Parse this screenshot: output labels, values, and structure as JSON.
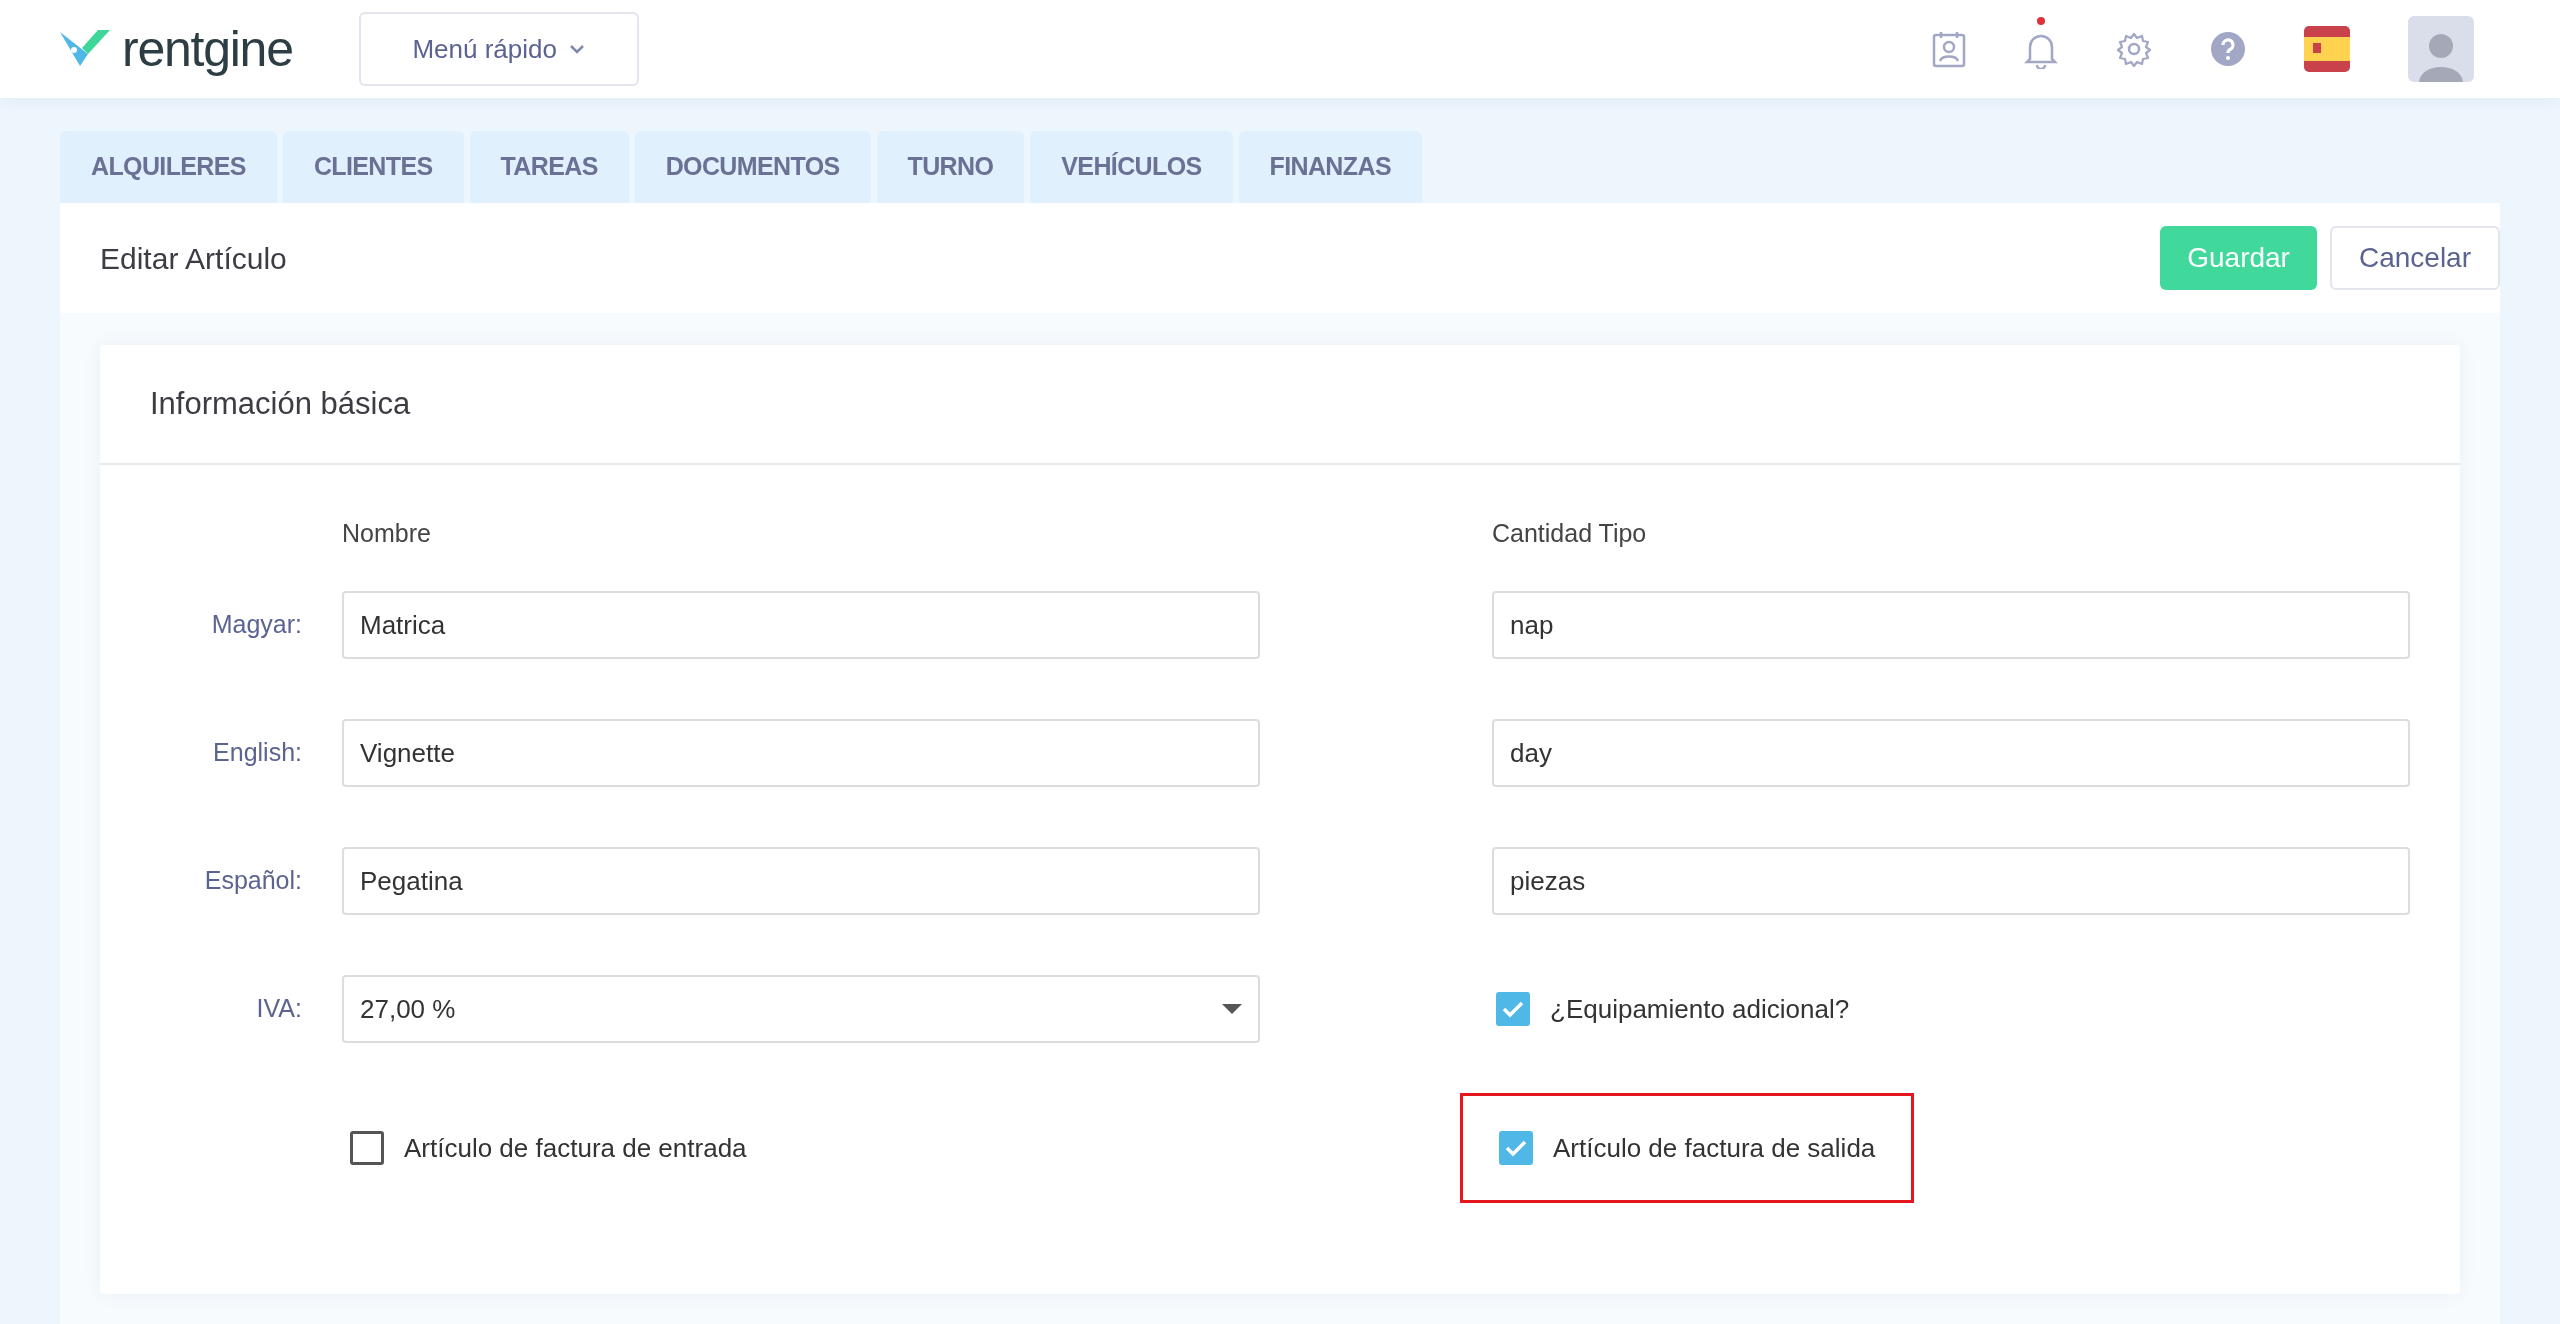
{
  "header": {
    "logo": "rentgine",
    "quick_menu": "Menú rápido",
    "notification_dot": true
  },
  "tabs": [
    {
      "label": "ALQUILERES",
      "selected": false
    },
    {
      "label": "CLIENTES",
      "selected": false
    },
    {
      "label": "TAREAS",
      "selected": false
    },
    {
      "label": "DOCUMENTOS",
      "selected": false
    },
    {
      "label": "TURNO",
      "selected": false
    },
    {
      "label": "VEHÍCULOS",
      "selected": false
    },
    {
      "label": "FINANZAS",
      "selected": false
    }
  ],
  "page": {
    "title": "Editar Artículo",
    "buttons": [
      {
        "label": "Guardar",
        "kind": "primary"
      },
      {
        "label": "Cancelar",
        "kind": "secondary"
      }
    ]
  },
  "card": {
    "title": "Información básica",
    "column_headers": [
      "Nombre",
      "Cantidad Tipo"
    ],
    "rows": [
      {
        "label": "Magyar:",
        "name": "Matrica",
        "quantity_type": "nap"
      },
      {
        "label": "English:",
        "name": "Vignette",
        "quantity_type": "day"
      },
      {
        "label": "Español:",
        "name": "Pegatina",
        "quantity_type": "piezas"
      }
    ],
    "vat": {
      "label": "IVA:",
      "value": "27,00 %"
    },
    "right_checkboxes": [
      {
        "label": "¿Equipamiento adicional?",
        "checked": true,
        "highlighted": false
      },
      {
        "label": "Artículo de factura de salida",
        "checked": true,
        "highlighted": true
      }
    ],
    "left_checkbox": {
      "label": "Artículo de factura de entrada",
      "checked": false
    }
  }
}
